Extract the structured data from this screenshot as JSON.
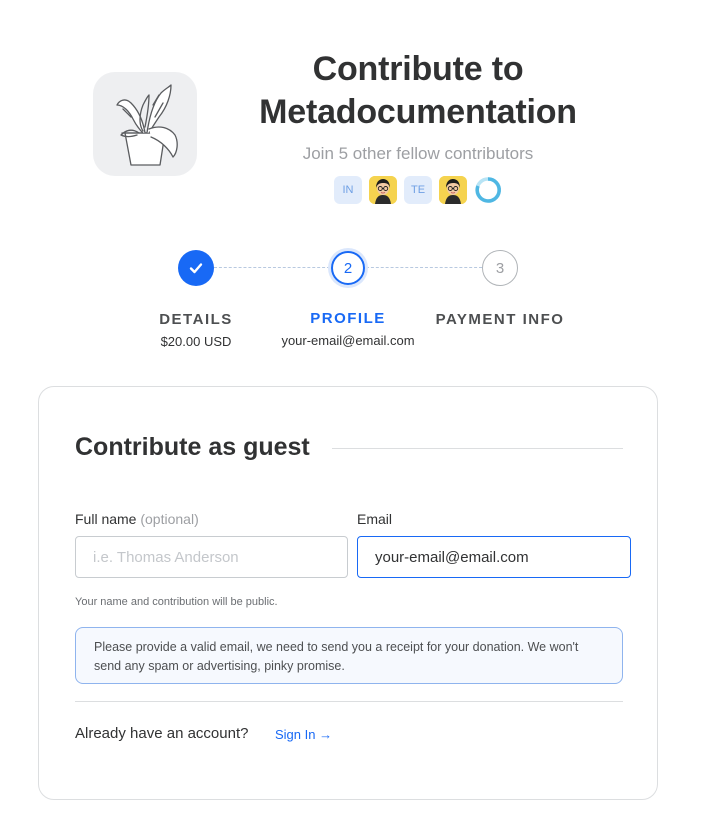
{
  "header": {
    "logo_icon": "plant-pot-icon",
    "title": "Contribute to Metadocumentation",
    "subtitle": "Join 5 other fellow contributors",
    "avatars": [
      {
        "type": "initials",
        "text": "IN"
      },
      {
        "type": "photo",
        "icon": "person-photo-icon"
      },
      {
        "type": "initials",
        "text": "TE"
      },
      {
        "type": "photo",
        "icon": "person-photo-icon"
      },
      {
        "type": "ring",
        "icon": "circle-ring-icon"
      }
    ]
  },
  "steps": [
    {
      "number": "1",
      "label": "DETAILS",
      "sub": "$20.00 USD",
      "state": "done"
    },
    {
      "number": "2",
      "label": "PROFILE",
      "sub": "your-email@email.com",
      "state": "active"
    },
    {
      "number": "3",
      "label": "PAYMENT INFO",
      "sub": "",
      "state": "todo"
    }
  ],
  "form": {
    "heading": "Contribute as guest",
    "fullname_label": "Full name",
    "fullname_optional": "(optional)",
    "fullname_placeholder": "i.e. Thomas Anderson",
    "fullname_value": "",
    "email_label": "Email",
    "email_value": "your-email@email.com",
    "hint": "Your name and contribution will be public.",
    "info": "Please provide a valid email, we need to send you a receipt for your donation. We won't send any spam or advertising, pinky promise.",
    "account_question": "Already have an account?",
    "signin_label": "Sign In →"
  },
  "colors": {
    "accent": "#1869f5",
    "text": "#313233",
    "muted": "#9d9fa3"
  }
}
